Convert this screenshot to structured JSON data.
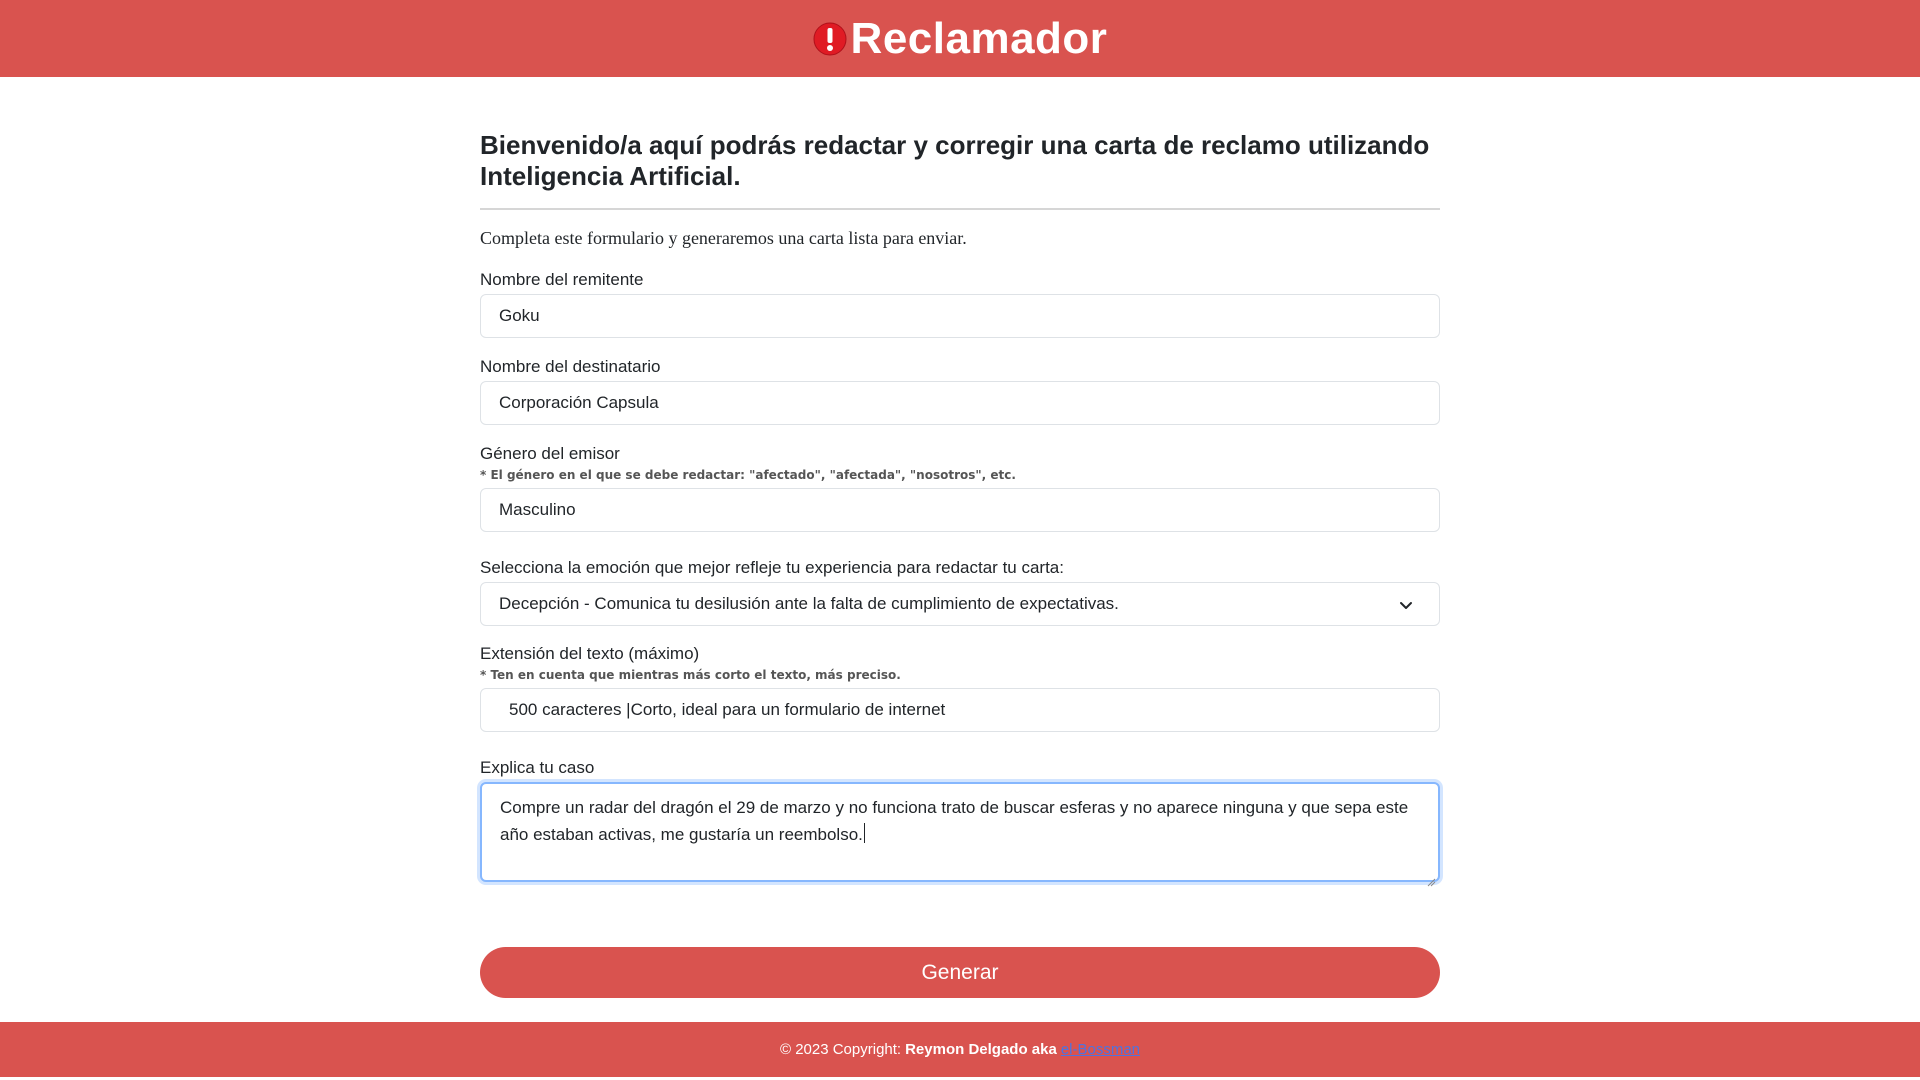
{
  "header": {
    "brand_name": "Reclamador",
    "brand_icon": "exclamation-circle-icon",
    "color": "#d9534f"
  },
  "main": {
    "title": "Bienvenido/a aquí podrás redactar y corregir una carta de reclamo utilizando Inteligencia Artificial.",
    "intro": "Completa este formulario y generaremos una carta lista para enviar."
  },
  "form": {
    "sender": {
      "label": "Nombre del remitente",
      "value": "Goku"
    },
    "recipient": {
      "label": "Nombre del destinatario",
      "value": "Corporación Capsula"
    },
    "gender": {
      "label": "Género del emisor",
      "hint": "* El género en el que se debe redactar: \"afectado\", \"afectada\", \"nosotros\", etc.",
      "value": "Masculino"
    },
    "emotion": {
      "label": "Selecciona la emoción que mejor refleje tu experiencia para redactar tu carta:",
      "selected": "Decepción - Comunica tu desilusión ante la falta de cumplimiento de expectativas."
    },
    "length": {
      "label": "Extensión del texto (máximo)",
      "hint": "* Ten en cuenta que mientras más corto el texto, más preciso.",
      "value": "500 caracteres |Corto, ideal para un formulario de internet"
    },
    "case": {
      "label": "Explica tu caso",
      "value": "Compre un radar del dragón el 29 de marzo y no funciona trato de buscar esferas y no aparece ninguna y que sepa este año estaban activas, me gustaría un reembolso."
    },
    "submit_label": "Generar"
  },
  "footer": {
    "copyright": "© 2023 Copyright:",
    "author": "Reymon Delgado aka",
    "link_text": "el-Bossman"
  }
}
